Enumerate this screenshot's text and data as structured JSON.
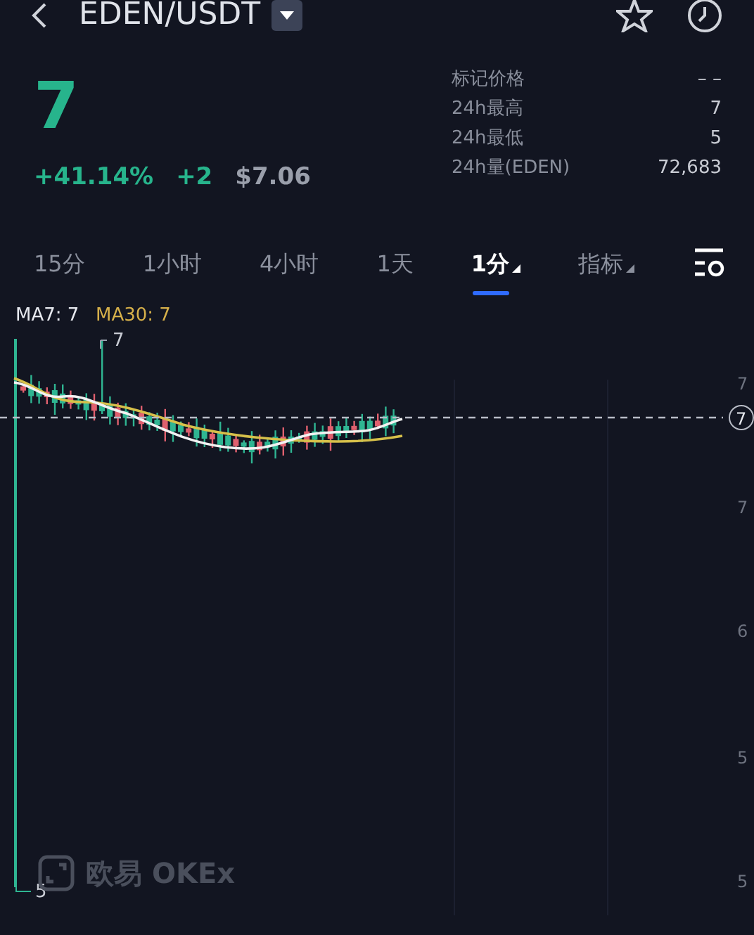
{
  "header": {
    "title": "EDEN/USDT"
  },
  "price": {
    "last": "7",
    "change_pct": "+41.14%",
    "change": "+2",
    "usd": "$7.06"
  },
  "stats": [
    {
      "label": "标记价格",
      "value": "– –"
    },
    {
      "label": "24h最高",
      "value": "7"
    },
    {
      "label": "24h最低",
      "value": "5"
    },
    {
      "label": "24h量(EDEN)",
      "value": "72,683"
    }
  ],
  "tabs": [
    {
      "label": "15分",
      "selected": false,
      "dropdown": false
    },
    {
      "label": "1小时",
      "selected": false,
      "dropdown": false
    },
    {
      "label": "4小时",
      "selected": false,
      "dropdown": false
    },
    {
      "label": "1天",
      "selected": false,
      "dropdown": false
    },
    {
      "label": "1分",
      "selected": true,
      "dropdown": true
    },
    {
      "label": "指标",
      "selected": false,
      "dropdown": true
    }
  ],
  "chart": {
    "ma7": "MA7: 7",
    "ma30": "MA30: 7",
    "high_marker": "7",
    "low_marker": "5",
    "last_price_tag": "7",
    "y_labels": [
      "7",
      "7",
      "6",
      "5",
      "5"
    ],
    "logo": "欧易 OKEx"
  }
}
